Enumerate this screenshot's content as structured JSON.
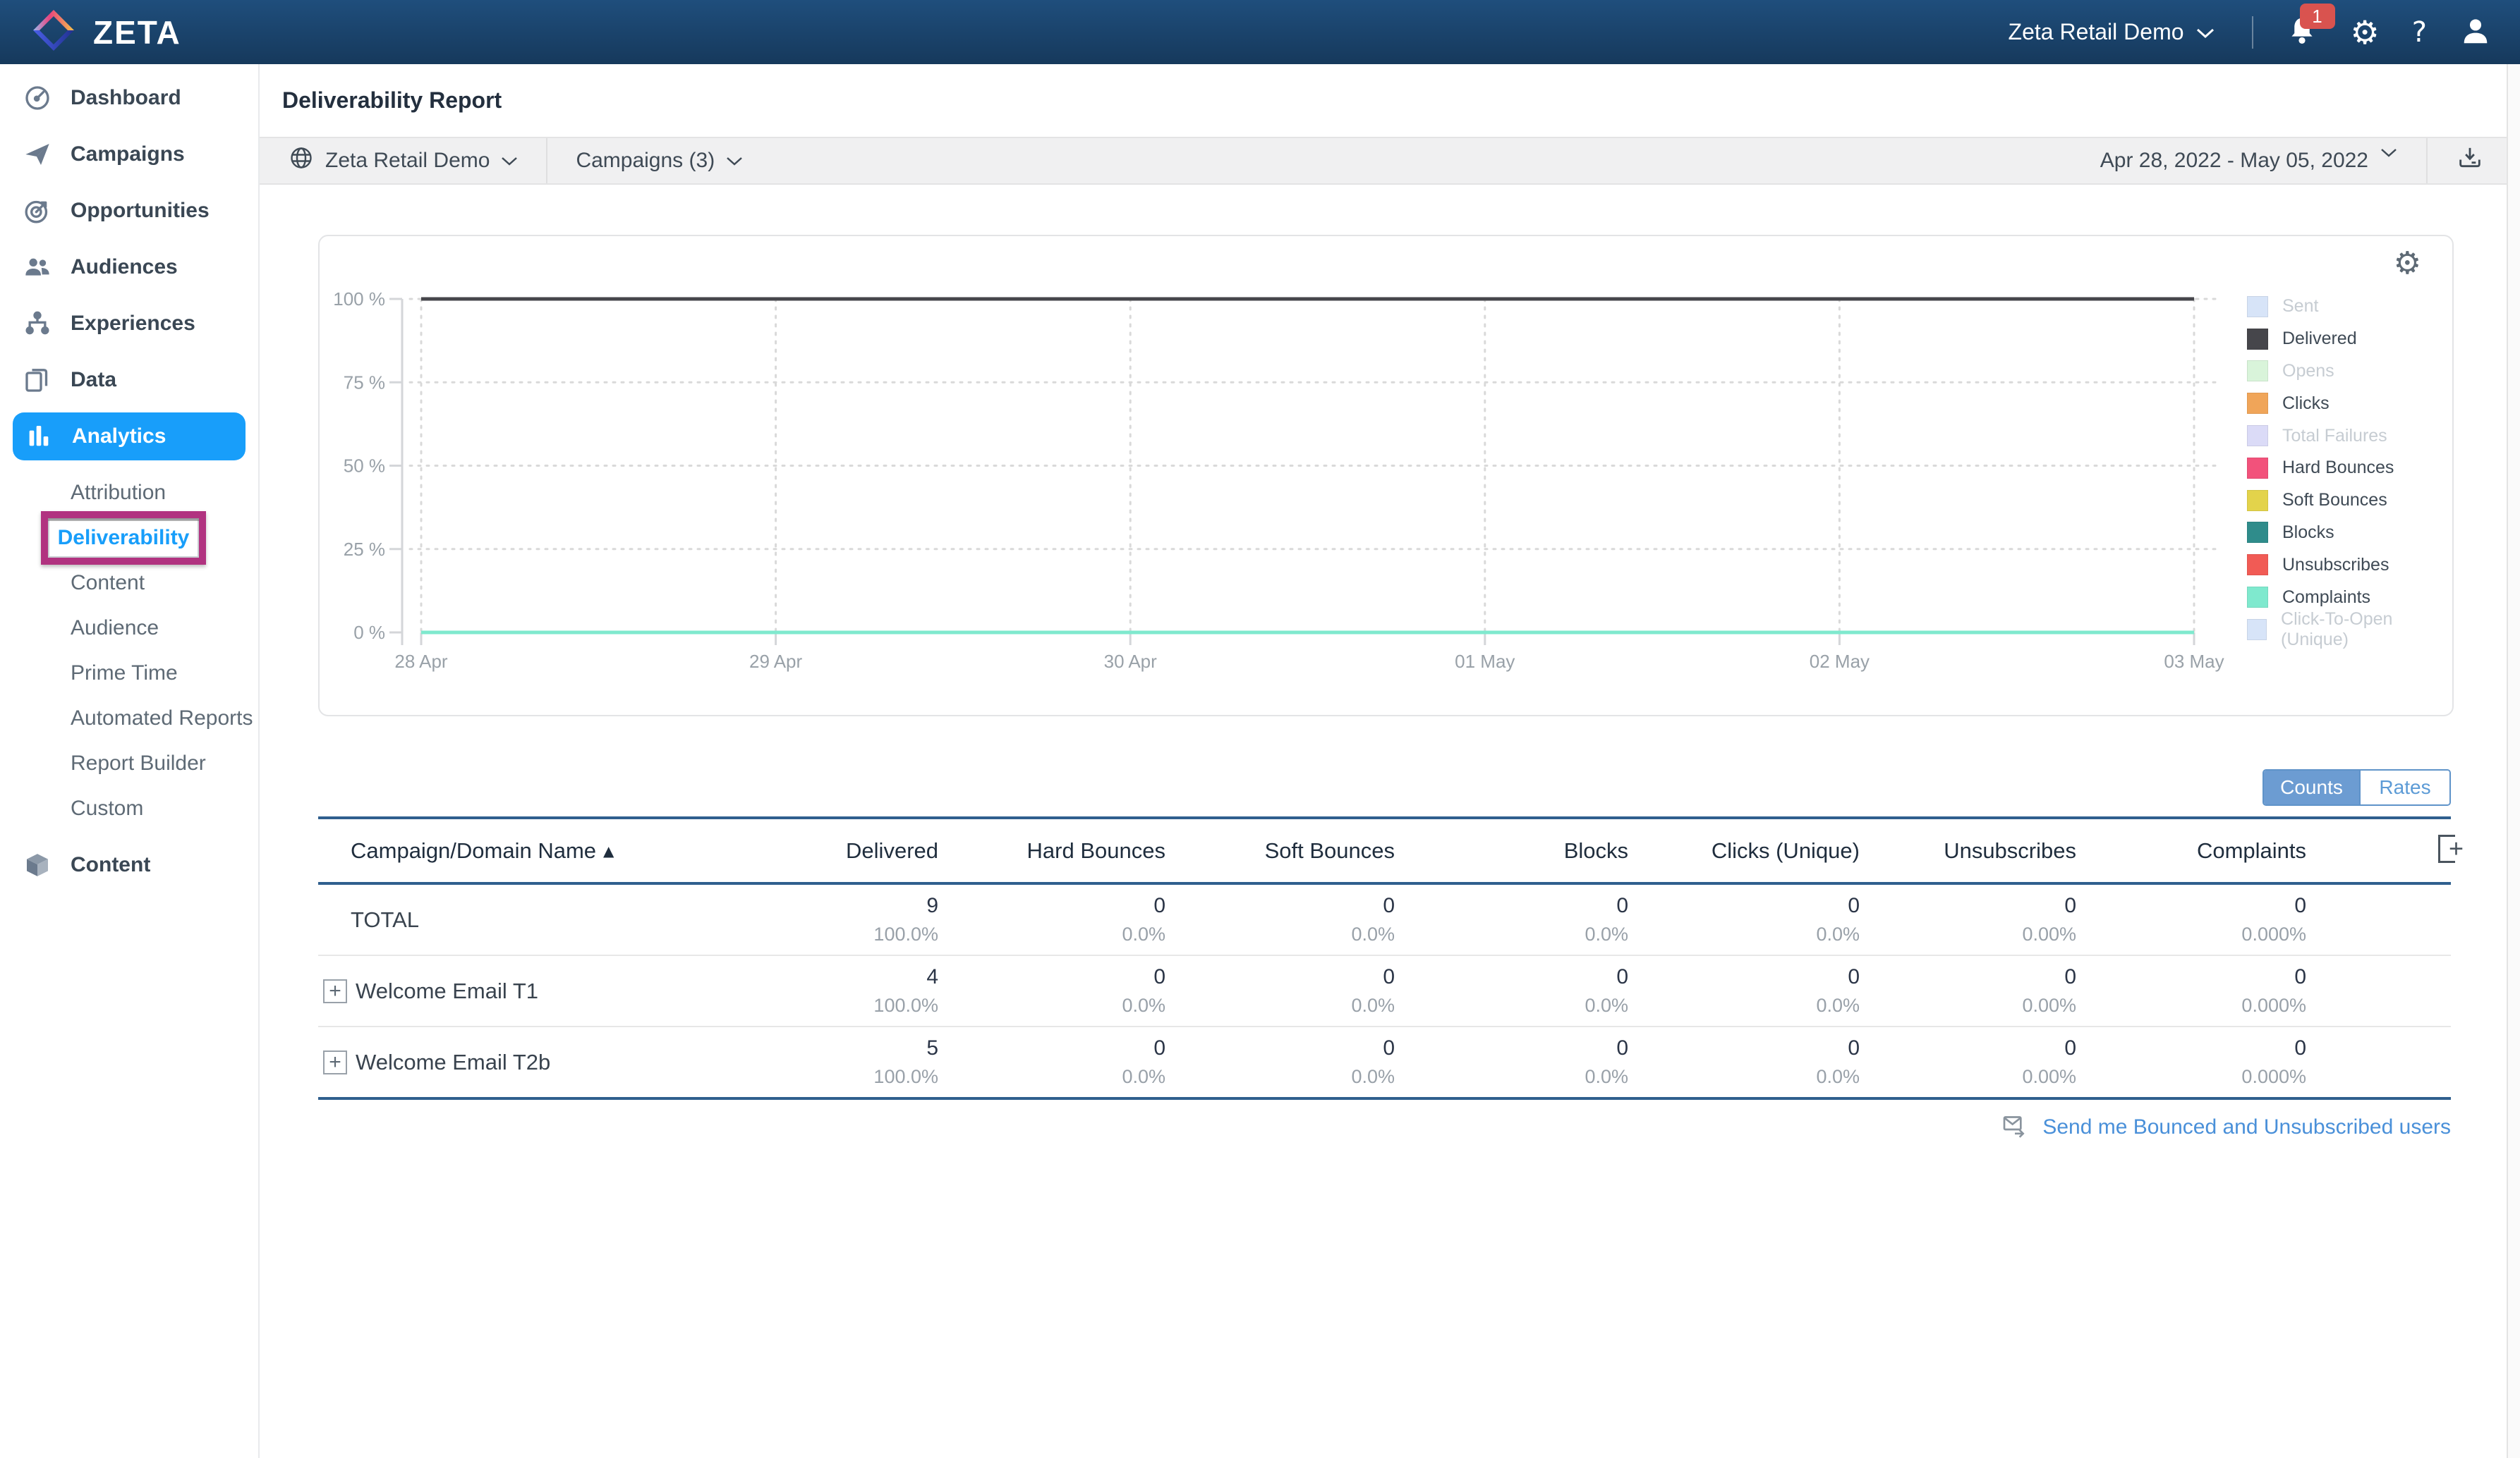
{
  "topbar": {
    "brand": "ZETA",
    "account": "Zeta Retail Demo",
    "notification_count": "1"
  },
  "icons": {
    "help": "?",
    "gear": "⚙",
    "sort_asc": "▲",
    "expand": "+",
    "add_column": "+"
  },
  "sidebar": {
    "items": [
      {
        "label": "Dashboard",
        "icon": "gauge-icon"
      },
      {
        "label": "Campaigns",
        "icon": "paper-plane-icon"
      },
      {
        "label": "Opportunities",
        "icon": "target-icon"
      },
      {
        "label": "Audiences",
        "icon": "people-icon"
      },
      {
        "label": "Experiences",
        "icon": "flow-icon"
      },
      {
        "label": "Data",
        "icon": "documents-icon"
      },
      {
        "label": "Analytics",
        "icon": "bar-chart-icon",
        "active": true,
        "sub": [
          {
            "label": "Attribution"
          },
          {
            "label": "Deliverability",
            "selected": true,
            "annotated": true
          },
          {
            "label": "Content"
          },
          {
            "label": "Audience"
          },
          {
            "label": "Prime Time"
          },
          {
            "label": "Automated Reports"
          },
          {
            "label": "Report Builder"
          },
          {
            "label": "Custom"
          }
        ]
      },
      {
        "label": "Content",
        "icon": "cube-icon"
      }
    ]
  },
  "page": {
    "title": "Deliverability Report"
  },
  "filters": {
    "account": "Zeta Retail Demo",
    "campaigns": "Campaigns (3)",
    "date_range": "Apr 28, 2022  - May 05, 2022"
  },
  "chart_data": {
    "type": "line",
    "x": [
      "28 Apr",
      "29 Apr",
      "30 Apr",
      "01 May",
      "02 May",
      "03 May"
    ],
    "y_ticks": [
      {
        "value": 0,
        "label": "0 %"
      },
      {
        "value": 25,
        "label": "25 %"
      },
      {
        "value": 50,
        "label": "50 %"
      },
      {
        "value": 75,
        "label": "75 %"
      },
      {
        "value": 100,
        "label": "100 %"
      }
    ],
    "ylim": [
      0,
      100
    ],
    "grid": "dotted",
    "legend_position": "right",
    "series": [
      {
        "name": "Sent",
        "color": "#D7E4F8",
        "enabled": false,
        "values": null
      },
      {
        "name": "Delivered",
        "color": "#46464B",
        "enabled": true,
        "values": [
          100,
          100,
          100,
          100,
          100,
          100
        ]
      },
      {
        "name": "Opens",
        "color": "#D9F4DA",
        "enabled": false,
        "values": null
      },
      {
        "name": "Clicks",
        "color": "#F0A559",
        "enabled": true,
        "values": [
          0,
          0,
          0,
          0,
          0,
          0
        ]
      },
      {
        "name": "Total Failures",
        "color": "#DBDBF7",
        "enabled": false,
        "values": null
      },
      {
        "name": "Hard Bounces",
        "color": "#F2527B",
        "enabled": true,
        "values": [
          0,
          0,
          0,
          0,
          0,
          0
        ]
      },
      {
        "name": "Soft Bounces",
        "color": "#E3D34B",
        "enabled": true,
        "values": [
          0,
          0,
          0,
          0,
          0,
          0
        ]
      },
      {
        "name": "Blocks",
        "color": "#2F8C8B",
        "enabled": true,
        "values": [
          0,
          0,
          0,
          0,
          0,
          0
        ]
      },
      {
        "name": "Unsubscribes",
        "color": "#F15B55",
        "enabled": true,
        "values": [
          0,
          0,
          0,
          0,
          0,
          0
        ]
      },
      {
        "name": "Complaints",
        "color": "#7FE9CE",
        "enabled": true,
        "values": [
          0,
          0,
          0,
          0,
          0,
          0
        ]
      },
      {
        "name": "Click-To-Open (Unique)",
        "color": "#D7E4F8",
        "enabled": false,
        "values": null
      }
    ]
  },
  "toggle": {
    "counts": "Counts",
    "rates": "Rates",
    "active": "Counts"
  },
  "table": {
    "columns": [
      "Campaign/Domain Name",
      "Delivered",
      "Hard Bounces",
      "Soft Bounces",
      "Blocks",
      "Clicks (Unique)",
      "Unsubscribes",
      "Complaints"
    ],
    "sort_column": "Campaign/Domain Name",
    "sort_direction": "asc",
    "rows": [
      {
        "name": "TOTAL",
        "expandable": false,
        "values": [
          [
            "9",
            "100.0%"
          ],
          [
            "0",
            "0.0%"
          ],
          [
            "0",
            "0.0%"
          ],
          [
            "0",
            "0.0%"
          ],
          [
            "0",
            "0.0%"
          ],
          [
            "0",
            "0.00%"
          ],
          [
            "0",
            "0.000%"
          ]
        ]
      },
      {
        "name": "Welcome Email T1",
        "expandable": true,
        "values": [
          [
            "4",
            "100.0%"
          ],
          [
            "0",
            "0.0%"
          ],
          [
            "0",
            "0.0%"
          ],
          [
            "0",
            "0.0%"
          ],
          [
            "0",
            "0.0%"
          ],
          [
            "0",
            "0.00%"
          ],
          [
            "0",
            "0.000%"
          ]
        ]
      },
      {
        "name": "Welcome Email T2b",
        "expandable": true,
        "values": [
          [
            "5",
            "100.0%"
          ],
          [
            "0",
            "0.0%"
          ],
          [
            "0",
            "0.0%"
          ],
          [
            "0",
            "0.0%"
          ],
          [
            "0",
            "0.0%"
          ],
          [
            "0",
            "0.00%"
          ],
          [
            "0",
            "0.000%"
          ]
        ]
      }
    ]
  },
  "footer_link": {
    "label": "Send me Bounced and Unsubscribed users"
  }
}
